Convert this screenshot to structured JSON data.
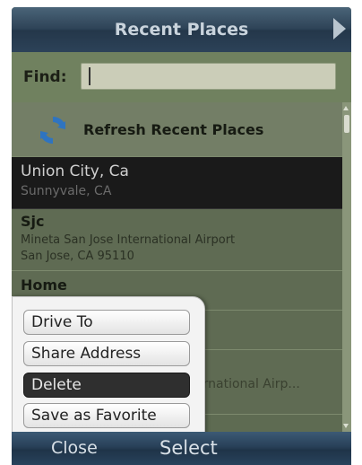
{
  "title": "Recent Places",
  "find": {
    "label": "Find:",
    "value": "",
    "placeholder": ""
  },
  "list": {
    "refresh_label": "Refresh Recent Places",
    "items": [
      {
        "name": "Union City, Ca",
        "sub": "Sunnyvale, CA"
      },
      {
        "name": "Sjc",
        "sub1": "Mineta San Jose International Airport",
        "sub2": "San Jose, CA 95110"
      },
      {
        "name": "Home"
      },
      {
        "name": ""
      },
      {
        "name": "",
        "sub": "ernational Airp..."
      }
    ]
  },
  "context_menu": {
    "items": [
      "Drive To",
      "Share Address",
      "Delete",
      "Save as Favorite"
    ],
    "selected": "Delete"
  },
  "softkeys": {
    "left": "Close",
    "center": "Select"
  },
  "colors": {
    "titlebar": "#2e4357",
    "list_bg": "#5f6b53",
    "selected_row": "#1a1a1a",
    "menu_selected": "#2f2f2f"
  }
}
